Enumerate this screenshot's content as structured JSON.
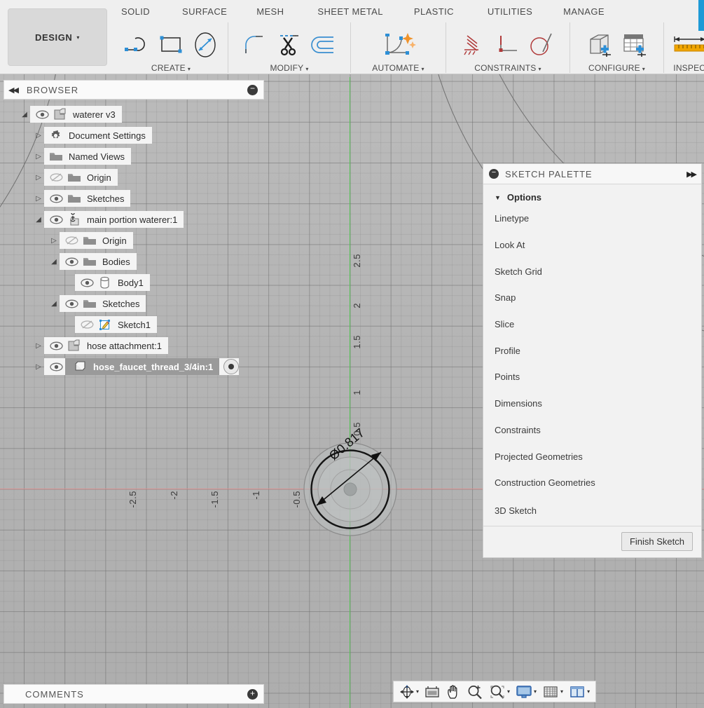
{
  "app": {
    "workspace_button": "DESIGN",
    "tabs": [
      "SOLID",
      "SURFACE",
      "MESH",
      "SHEET METAL",
      "PLASTIC",
      "UTILITIES",
      "MANAGE"
    ],
    "accent_blue": "#1e9ad6",
    "panel_bg": "#f2f2f2",
    "canvas_bg": "#b5b5b5",
    "x_axis_color": "#d98f8f",
    "y_axis_color": "#54c254"
  },
  "ribbon_groups": [
    {
      "label": "CREATE",
      "caret": "▾",
      "icons": [
        "line-icon",
        "rectangle-icon",
        "circle-icon"
      ]
    },
    {
      "label": "MODIFY",
      "caret": "▾",
      "icons": [
        "fillet-icon",
        "trim-icon",
        "offset-icon"
      ]
    },
    {
      "label": "AUTOMATE",
      "caret": "▾",
      "icons": [
        "auto-constrain-icon"
      ]
    },
    {
      "label": "CONSTRAINTS",
      "caret": "▾",
      "icons": [
        "fix-icon",
        "perpendicular-icon",
        "tangent-icon"
      ]
    },
    {
      "label": "CONFIGURE",
      "caret": "▾",
      "icons": [
        "configure-part-icon",
        "configure-table-icon"
      ]
    },
    {
      "label": "INSPECT",
      "caret": "",
      "icons": [
        "measure-icon"
      ]
    }
  ],
  "browser": {
    "title": "BROWSER",
    "collapse_icon": "collapse-left-icon",
    "minimize_icon": "minimize-icon",
    "items": [
      {
        "label": "waterer v3",
        "twist": "open",
        "indent": 0,
        "eye": "visible",
        "icon": "component-icon",
        "selected": false
      },
      {
        "label": "Document Settings",
        "twist": "closed",
        "indent": 1,
        "eye": "none",
        "icon": "gear-icon",
        "selected": false
      },
      {
        "label": "Named Views",
        "twist": "closed",
        "indent": 1,
        "eye": "none",
        "icon": "folder-icon",
        "selected": false
      },
      {
        "label": "Origin",
        "twist": "closed",
        "indent": 1,
        "eye": "hidden",
        "icon": "folder-icon",
        "selected": false
      },
      {
        "label": "Sketches",
        "twist": "closed",
        "indent": 1,
        "eye": "visible",
        "icon": "folder-icon",
        "selected": false
      },
      {
        "label": "main portion waterer:1",
        "twist": "open",
        "indent": 1,
        "eye": "visible",
        "icon": "grounded-component-icon",
        "selected": false
      },
      {
        "label": "Origin",
        "twist": "closed",
        "indent": 2,
        "eye": "hidden",
        "icon": "folder-icon",
        "selected": false
      },
      {
        "label": "Bodies",
        "twist": "open",
        "indent": 2,
        "eye": "visible",
        "icon": "folder-icon",
        "selected": false
      },
      {
        "label": "Body1",
        "twist": "none",
        "indent": 3,
        "eye": "visible",
        "icon": "body-icon",
        "selected": false
      },
      {
        "label": "Sketches",
        "twist": "open",
        "indent": 2,
        "eye": "visible",
        "icon": "folder-icon",
        "selected": false
      },
      {
        "label": "Sketch1",
        "twist": "none",
        "indent": 3,
        "eye": "hidden",
        "icon": "sketch-icon",
        "selected": false
      },
      {
        "label": "hose attachment:1",
        "twist": "closed",
        "indent": 1,
        "eye": "visible",
        "icon": "component-icon",
        "selected": false
      },
      {
        "label": "hose_faucet_thread_3/4in:1",
        "twist": "closed",
        "indent": 1,
        "eye": "visible",
        "icon": "body-solid-icon",
        "selected": true
      }
    ]
  },
  "sketch_palette": {
    "title": "SKETCH PALETTE",
    "minimize_icon": "minimize-icon",
    "expand_icon": "expand-right-icon",
    "section": "Options",
    "section_caret": "▼",
    "rows": [
      {
        "label": "Linetype",
        "control": "icon-pair",
        "icons": [
          "construction-line-icon",
          "linetype-icon"
        ]
      },
      {
        "label": "Look At",
        "control": "icon",
        "icons": [
          "look-at-icon"
        ]
      },
      {
        "label": "Sketch Grid",
        "control": "checkbox",
        "checked": true
      },
      {
        "label": "Snap",
        "control": "checkbox",
        "checked": true
      },
      {
        "label": "Slice",
        "control": "checkbox",
        "checked": false
      },
      {
        "label": "Profile",
        "control": "checkbox",
        "checked": true
      },
      {
        "label": "Points",
        "control": "checkbox",
        "checked": true
      },
      {
        "label": "Dimensions",
        "control": "checkbox",
        "checked": true
      },
      {
        "label": "Constraints",
        "control": "checkbox",
        "checked": true
      },
      {
        "label": "Projected Geometries",
        "control": "checkbox",
        "checked": true
      },
      {
        "label": "Construction Geometries",
        "control": "checkbox",
        "checked": true
      },
      {
        "label": "3D Sketch",
        "control": "checkbox",
        "checked": false
      }
    ],
    "finish_button": "Finish Sketch"
  },
  "canvas": {
    "dimension_label": "Ø0.817",
    "x_ticks": [
      "-2.5",
      "-2",
      "-1.5",
      "-1",
      "-0.5"
    ],
    "y_ticks": [
      "2.5",
      "2",
      "1.5",
      "1",
      "0.5"
    ]
  },
  "comments": {
    "title": "COMMENTS",
    "add_icon": "add-icon"
  },
  "navbar": {
    "buttons": [
      {
        "name": "orbit-icon",
        "caret": "▾"
      },
      {
        "name": "look-at-icon",
        "caret": ""
      },
      {
        "name": "pan-icon",
        "caret": ""
      },
      {
        "name": "zoom-icon",
        "caret": ""
      },
      {
        "name": "zoom-window-icon",
        "caret": "▾"
      },
      {
        "name": "display-settings-icon",
        "caret": "▾"
      },
      {
        "name": "grid-settings-icon",
        "caret": "▾"
      },
      {
        "name": "viewports-icon",
        "caret": "▾"
      }
    ]
  }
}
